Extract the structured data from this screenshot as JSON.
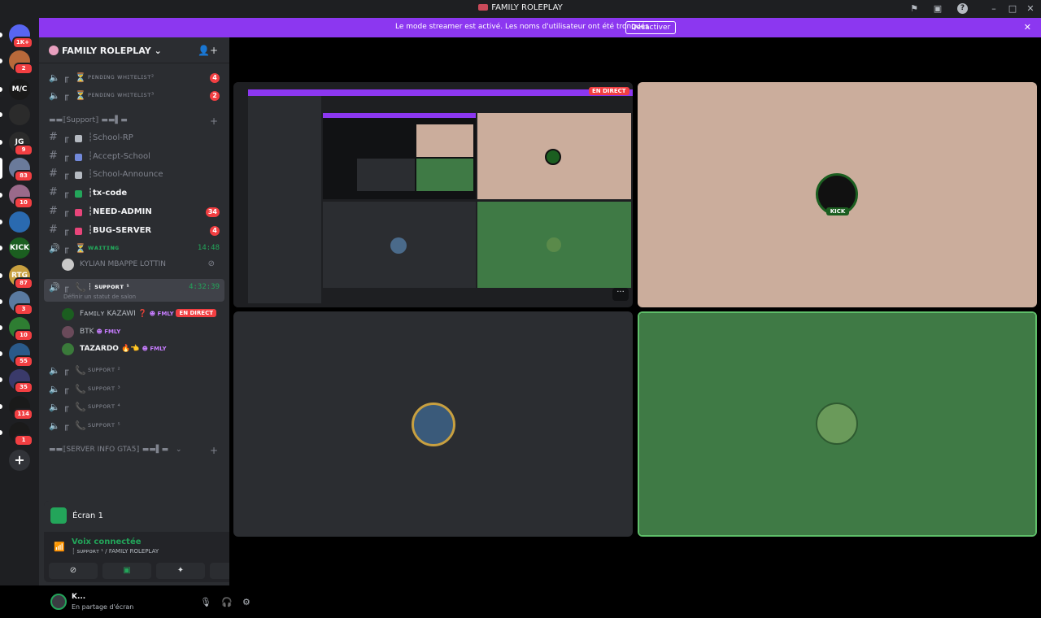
{
  "app": {
    "title": "FAMILY ROLEPLAY"
  },
  "banner": {
    "message": "Le mode streamer est activé. Les noms d'utilisateur ont été tronqués.",
    "button": "Désactiver"
  },
  "server": {
    "name": "FAMILY ROLEPLAY"
  },
  "rail_servers": [
    {
      "badge": "1K+",
      "color": "#5865f2",
      "text": ""
    },
    {
      "badge": "2",
      "color": "#b8693a",
      "text": ""
    },
    {
      "badge": "",
      "color": "#1a1a1a",
      "text": "M/C"
    },
    {
      "badge": "",
      "color": "#2b2b2b",
      "text": ""
    },
    {
      "badge": "9",
      "color": "#2b2b2b",
      "text": "JG"
    },
    {
      "badge": "83",
      "color": "#6a7a9a",
      "text": ""
    },
    {
      "badge": "10",
      "color": "#9a6a8a",
      "text": ""
    },
    {
      "badge": "",
      "color": "#2a6ab0",
      "text": ""
    },
    {
      "badge": "",
      "color": "#1b5e20",
      "text": "KICK"
    },
    {
      "badge": "87",
      "color": "#c8a040",
      "text": "RTG"
    },
    {
      "badge": "3",
      "color": "#5a7aa0",
      "text": ""
    },
    {
      "badge": "10",
      "color": "#2e7d32",
      "text": ""
    },
    {
      "badge": "55",
      "color": "#2a5a8a",
      "text": ""
    },
    {
      "badge": "35",
      "color": "#3a3a6a",
      "text": ""
    },
    {
      "badge": "114",
      "color": "#1a1a1a",
      "text": ""
    },
    {
      "badge": "1",
      "color": "#1a1a1a",
      "text": ""
    }
  ],
  "channels_top": [
    {
      "name": "ᴘᴇɴᴅɪɴɢ ᴡʜɪᴛᴇʟɪsᴛ²",
      "count": "4"
    },
    {
      "name": "ᴘᴇɴᴅɪɴɢ ᴡʜɪᴛᴇʟɪsᴛ³",
      "count": "2"
    }
  ],
  "category_support": "▬▬⟦Support⟧ ▬▬▌▬",
  "text_channels": [
    {
      "name": "┆School-RP",
      "count": "",
      "style": "muted",
      "emoji_color": "#b5bac1"
    },
    {
      "name": "┆Accept-School",
      "count": "",
      "style": "muted",
      "emoji_color": "#7289da"
    },
    {
      "name": "┆School-Announce",
      "count": "",
      "style": "muted",
      "emoji_color": "#b5bac1"
    },
    {
      "name": "┆tx-code",
      "count": "",
      "style": "bright",
      "emoji_color": "#23a55a"
    },
    {
      "name": "┆NEED-ADMIN",
      "count": "34",
      "style": "bright",
      "emoji_color": "#e8457a"
    },
    {
      "name": "┆BUG-SERVER",
      "count": "4",
      "style": "bright",
      "emoji_color": "#e8457a"
    }
  ],
  "waiting": {
    "name": "ᴡᴀɪᴛɪɴɢ",
    "timer": "14:48",
    "member": "KYLIAN MBAPPE LOTTIN"
  },
  "support1": {
    "name": "┆ sᴜᴘᴘᴏʀᴛ ¹",
    "timer": "4:32:39",
    "status": "Définir un statut de salon",
    "members": [
      {
        "name": "Fᴀᴍɪʟʏ KAZAWI ❓",
        "tag": "FMLY",
        "live": "EN DIRECT",
        "color": "#1b5e20"
      },
      {
        "name": "BTK",
        "tag": "FMLY",
        "live": "",
        "color": "#6a4a5a"
      },
      {
        "name": "TAZARDO 🔥👈",
        "tag": "FMLY",
        "live": "",
        "color": "#3a7a3a"
      }
    ]
  },
  "support_channels": [
    {
      "name": "sᴜᴘᴘᴏʀᴛ ²"
    },
    {
      "name": "sᴜᴘᴘᴏʀᴛ ³"
    },
    {
      "name": "sᴜᴘᴘᴏʀᴛ ⁴"
    },
    {
      "name": "sᴜᴘᴘᴏʀᴛ ⁵"
    }
  ],
  "category_info": "▬▬⟦SERVER INFO GTA5⟧ ▬▬▌▬",
  "voice_panel": {
    "screen_title": "Écran 1",
    "status": "Voix connectée",
    "sub": "┆ sᴜᴘᴘᴏʀᴛ ¹ / FAMILY ROLEPLAY"
  },
  "user": {
    "name": "K...",
    "status": "En partage d'écran"
  },
  "stage": {
    "live_badge": "EN DIRECT",
    "tile_colors": {
      "tan": "#cbad9c",
      "dark": "#2b2d31",
      "green": "#3f7a45"
    }
  }
}
